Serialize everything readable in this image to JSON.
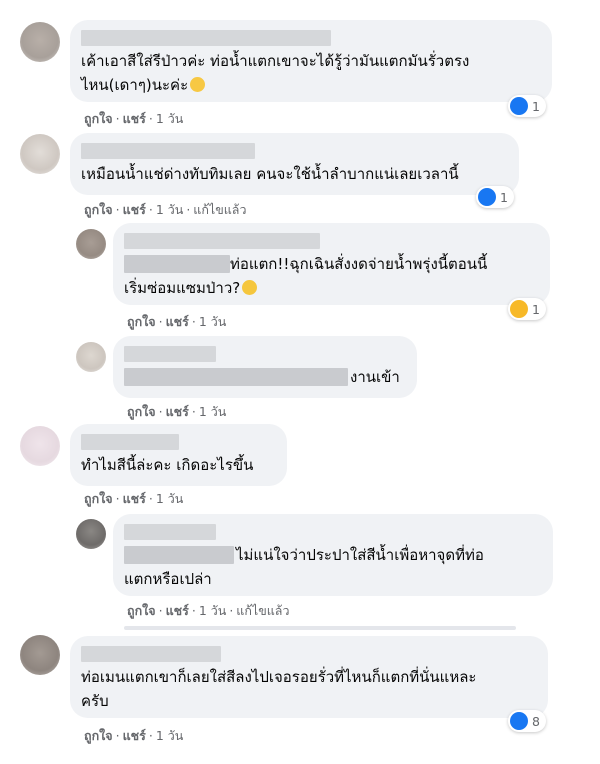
{
  "actions": {
    "like": "ถูกใจ",
    "share": "แชร์",
    "dot": "·",
    "time": "1 วัน",
    "edited": "แก้ไขแล้ว"
  },
  "comments": [
    {
      "line1": "เค้าเอาสีใส่รีป่าวค่ะ ท่อน้ำแตกเขาจะได้รู้ว่ามันแตกมันรั่วตรง",
      "line2": "ไหน(เดาๆ)นะค่ะ",
      "reaction_count": "1"
    },
    {
      "line1": "เหมือนน้ำแช่ด่างทับทิมเลย คนจะใช้น้ำลำบากแน่เลยเวลานี้",
      "reaction_count": "1"
    },
    {
      "line1": "ท่อแตก!!ฉุกเฉินสั่งงดจ่ายน้ำพรุ่งนี้ตอนนี้",
      "line2": "เริ่มซ่อมแซมป่าว?",
      "reaction_count": "1"
    },
    {
      "line1": "งานเข้า"
    },
    {
      "line1": "ทำไมสีนี้ล่ะคะ เกิดอะไรขึ้น"
    },
    {
      "line1": "ไม่แน่ใจว่าประปาใส่สีน้ำเพื่อหาจุดที่ท่อ",
      "line2": "แตกหรือเปล่า"
    },
    {
      "line1": "ท่อเมนแตกเขาก็เลยใส่สีลงไปเจอรอยรั่วที่ไหนก็แตกที่นั่นแหละ",
      "line2": "ครับ",
      "reaction_count": "8"
    }
  ],
  "colors": {
    "like": "#1877f2",
    "wow": "#f7b928",
    "bubble": "#f0f2f5",
    "meta": "#65676b"
  },
  "icons": [
    "like-icon",
    "wow-icon",
    "smile-emoji",
    "thinking-emoji"
  ]
}
